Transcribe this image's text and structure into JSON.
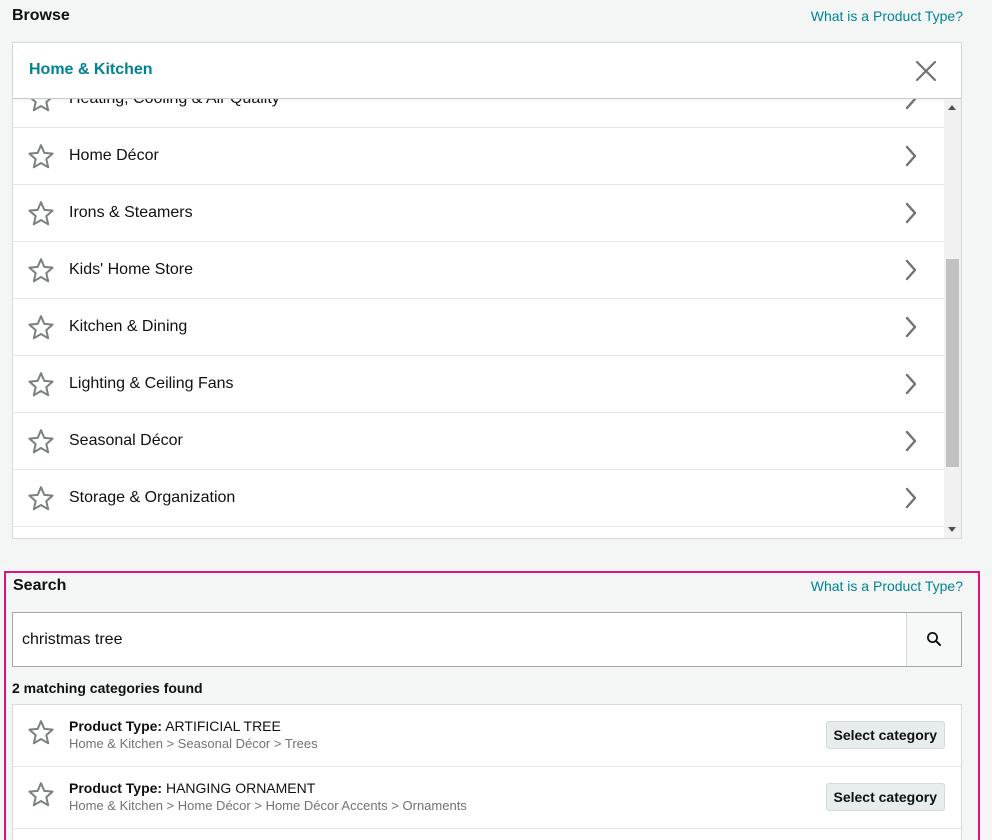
{
  "browse": {
    "title": "Browse",
    "help_link": "What is a Product Type?",
    "category": "Home & Kitchen",
    "items": [
      {
        "label": "Heating, Cooling & Air Quality"
      },
      {
        "label": "Home Décor"
      },
      {
        "label": "Irons & Steamers"
      },
      {
        "label": "Kids' Home Store"
      },
      {
        "label": "Kitchen & Dining"
      },
      {
        "label": "Lighting & Ceiling Fans"
      },
      {
        "label": "Seasonal Décor"
      },
      {
        "label": "Storage & Organization"
      }
    ]
  },
  "search": {
    "title": "Search",
    "help_link": "What is a Product Type?",
    "query": "christmas tree",
    "match_count": "2 matching categories found",
    "results": [
      {
        "type_label": "Product Type:",
        "type_value": "ARTIFICIAL TREE",
        "path": [
          "Home & Kitchen",
          "Seasonal Décor",
          "Trees"
        ],
        "button": "Select category"
      },
      {
        "type_label": "Product Type:",
        "type_value": "HANGING ORNAMENT",
        "path": [
          "Home & Kitchen",
          "Home Décor",
          "Home Décor Accents",
          "Ornaments"
        ],
        "button": "Select category"
      }
    ]
  },
  "colors": {
    "accent": "#008296",
    "highlight_border": "#e0137c",
    "background": "#f4f6f6",
    "icon_gray": "#7a8080"
  },
  "icons": {
    "favorite": "star-outline-icon",
    "expand": "chevron-right-icon",
    "close": "close-icon",
    "search": "search-icon"
  }
}
